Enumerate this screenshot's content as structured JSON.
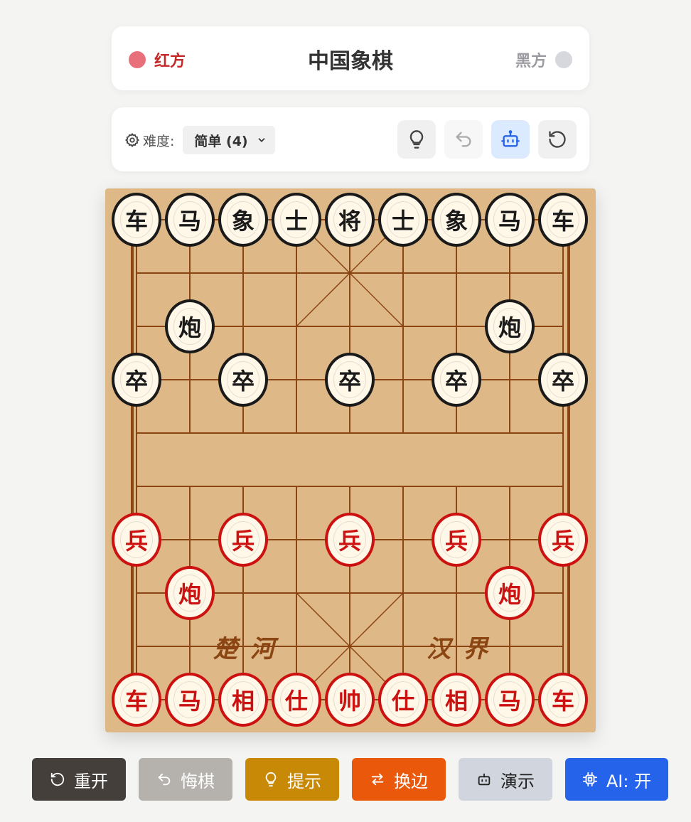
{
  "header": {
    "red_label": "红方",
    "title": "中国象棋",
    "black_label": "黑方"
  },
  "toolbar": {
    "difficulty_label": "难度:",
    "difficulty_value": "简单 (4)",
    "icons": [
      "lightbulb-icon",
      "undo-icon",
      "robot-icon",
      "restart-icon"
    ]
  },
  "board": {
    "river_left": "楚河",
    "river_right": "汉界",
    "black_pieces": [
      {
        "t": "车",
        "c": 0,
        "r": 0
      },
      {
        "t": "马",
        "c": 1,
        "r": 0
      },
      {
        "t": "象",
        "c": 2,
        "r": 0
      },
      {
        "t": "士",
        "c": 3,
        "r": 0
      },
      {
        "t": "将",
        "c": 4,
        "r": 0
      },
      {
        "t": "士",
        "c": 5,
        "r": 0
      },
      {
        "t": "象",
        "c": 6,
        "r": 0
      },
      {
        "t": "马",
        "c": 7,
        "r": 0
      },
      {
        "t": "车",
        "c": 8,
        "r": 0
      },
      {
        "t": "炮",
        "c": 1,
        "r": 2
      },
      {
        "t": "炮",
        "c": 7,
        "r": 2
      },
      {
        "t": "卒",
        "c": 0,
        "r": 3
      },
      {
        "t": "卒",
        "c": 2,
        "r": 3
      },
      {
        "t": "卒",
        "c": 4,
        "r": 3
      },
      {
        "t": "卒",
        "c": 6,
        "r": 3
      },
      {
        "t": "卒",
        "c": 8,
        "r": 3
      }
    ],
    "red_pieces": [
      {
        "t": "兵",
        "c": 0,
        "r": 6
      },
      {
        "t": "兵",
        "c": 2,
        "r": 6
      },
      {
        "t": "兵",
        "c": 4,
        "r": 6
      },
      {
        "t": "兵",
        "c": 6,
        "r": 6
      },
      {
        "t": "兵",
        "c": 8,
        "r": 6
      },
      {
        "t": "炮",
        "c": 1,
        "r": 7
      },
      {
        "t": "炮",
        "c": 7,
        "r": 7
      },
      {
        "t": "车",
        "c": 0,
        "r": 9
      },
      {
        "t": "马",
        "c": 1,
        "r": 9
      },
      {
        "t": "相",
        "c": 2,
        "r": 9
      },
      {
        "t": "仕",
        "c": 3,
        "r": 9
      },
      {
        "t": "帅",
        "c": 4,
        "r": 9
      },
      {
        "t": "仕",
        "c": 5,
        "r": 9
      },
      {
        "t": "相",
        "c": 6,
        "r": 9
      },
      {
        "t": "马",
        "c": 7,
        "r": 9
      },
      {
        "t": "车",
        "c": 8,
        "r": 9
      }
    ]
  },
  "buttons": {
    "restart": "重开",
    "undo": "悔棋",
    "hint": "提示",
    "swap": "换边",
    "demo": "演示",
    "ai": "AI: 开"
  },
  "colors": {
    "red": "#cc1111",
    "black": "#1a1a1a",
    "board": "#deb887",
    "grid": "#8b4513",
    "accent": "#2563eb"
  }
}
